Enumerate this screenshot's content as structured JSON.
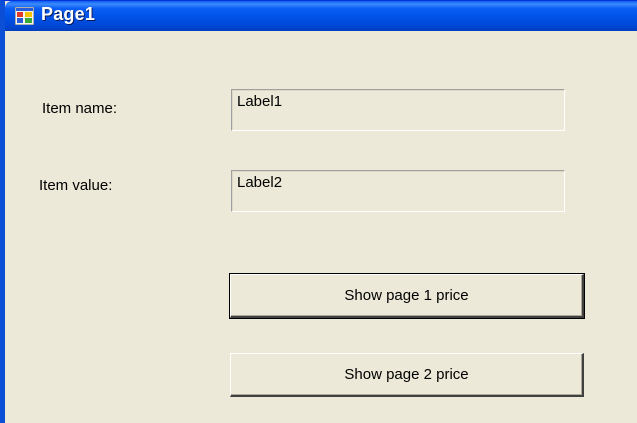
{
  "window": {
    "title": "Page1",
    "icon": "windows-app-icon"
  },
  "form": {
    "item_name_label": "Item name:",
    "item_name_value": "Label1",
    "item_value_label": "Item value:",
    "item_value_value": "Label2",
    "show_page1_button": "Show page 1 price",
    "show_page2_button": "Show page 2 price"
  },
  "colors": {
    "titlebar": "#0052e6",
    "window_bg": "#ece9d8",
    "title_text": "#ffffff"
  }
}
